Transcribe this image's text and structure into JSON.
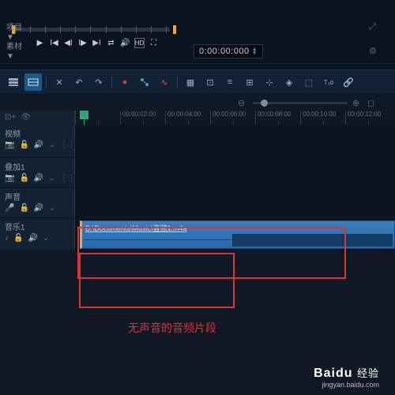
{
  "preview": {
    "labels": {
      "project": "项目▼",
      "material": "素材▼"
    },
    "timecode": "0:00:00:000"
  },
  "ruler": {
    "ticks": [
      "",
      "00:00:02:00",
      "00:00:04:00",
      "00:00:06:00",
      "00:00:08:00",
      "00:00:10:00",
      "00:00:12:00"
    ]
  },
  "tracks": {
    "video": {
      "name": "视频"
    },
    "overlay": {
      "name": "叠加1"
    },
    "voice": {
      "name": "声音"
    },
    "music": {
      "name": "音乐1",
      "clip_path": "D:\\Documents\\Music\\音频1.m4a"
    }
  },
  "annotation": "无声音的音频片段",
  "watermark": {
    "brand": "Baidu",
    "brand_cn": "经验",
    "url": "jingyan.baidu.com"
  }
}
